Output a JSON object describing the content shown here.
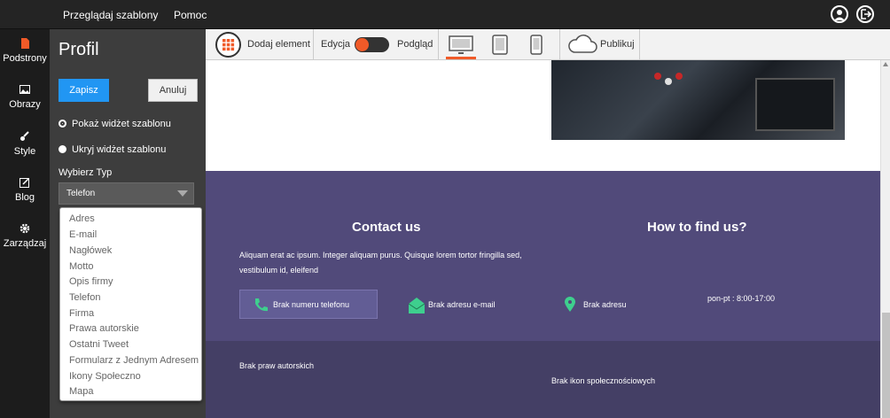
{
  "topbar": {
    "nav_templates": "Przeglądaj szablony",
    "nav_help": "Pomoc"
  },
  "leftnav": {
    "items": [
      {
        "label": "Podstrony",
        "icon": "file-icon"
      },
      {
        "label": "Obrazy",
        "icon": "image-icon"
      },
      {
        "label": "Style",
        "icon": "brush-icon"
      },
      {
        "label": "Blog",
        "icon": "edit-icon"
      },
      {
        "label": "Zarządzaj",
        "icon": "gear-icon"
      }
    ]
  },
  "panel": {
    "title": "Profil",
    "save_label": "Zapisz",
    "cancel_label": "Anuluj",
    "radio_show": "Pokaż widżet szablonu",
    "radio_hide": "Ukryj widżet szablonu",
    "type_label": "Wybierz Typ",
    "type_value": "Telefon",
    "dropdown_options": [
      "Adres",
      "E-mail",
      "Nagłówek",
      "Motto",
      "Opis firmy",
      "Telefon",
      "Firma",
      "Prawa autorskie",
      "Ostatni Tweet",
      "Formularz z Jednym Adresem E",
      "Ikony Społeczno",
      "Mapa"
    ]
  },
  "toolbar": {
    "add_element": "Dodaj element",
    "edit_label": "Edycja",
    "preview_label": "Podgląd",
    "publish_label": "Publikuj"
  },
  "content": {
    "contact_title": "Contact us",
    "contact_text": "Aliquam erat ac ipsum. Integer aliquam purus. Quisque lorem tortor fringilla sed, vestibulum id, eleifend",
    "phone": "Brak numeru telefonu",
    "email": "Brak adresu e-mail",
    "address": "Brak adresu",
    "find_title": "How to find us?",
    "hours": "pon-pt : 8:00-17:00",
    "copyright": "Brak praw autorskich",
    "social": "Brak ikon społecznościowych"
  },
  "colors": {
    "accent_blue": "#2196f3",
    "toggle_orange": "#f05a28",
    "contact_bg": "#514a7a",
    "footer_bg": "#443f65",
    "icon_green": "#3ecf8e"
  }
}
